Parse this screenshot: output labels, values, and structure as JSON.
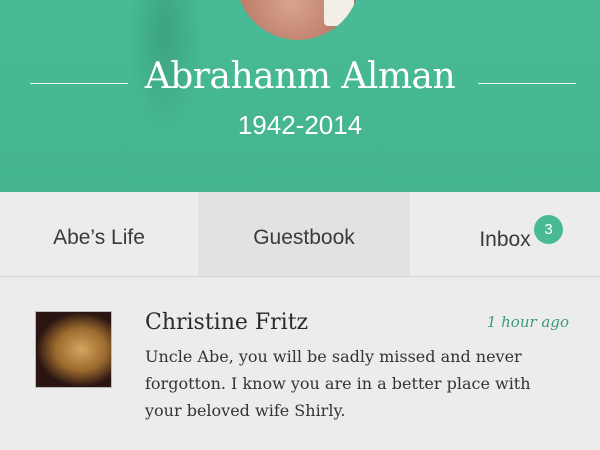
{
  "profile": {
    "name": "Abrahanm Alman",
    "dates": "1942-2014"
  },
  "tabs": [
    {
      "label": "Abe’s Life"
    },
    {
      "label": "Guestbook",
      "active": true
    },
    {
      "label": "Inbox",
      "badge": "3"
    }
  ],
  "comments": [
    {
      "author": "Christine Fritz",
      "time": "1 hour ago",
      "message": "Uncle Abe, you will be sadly missed and never forgotton.  I know you are in a better place with your beloved wife Shirly."
    }
  ],
  "colors": {
    "accent": "#48bb96"
  }
}
